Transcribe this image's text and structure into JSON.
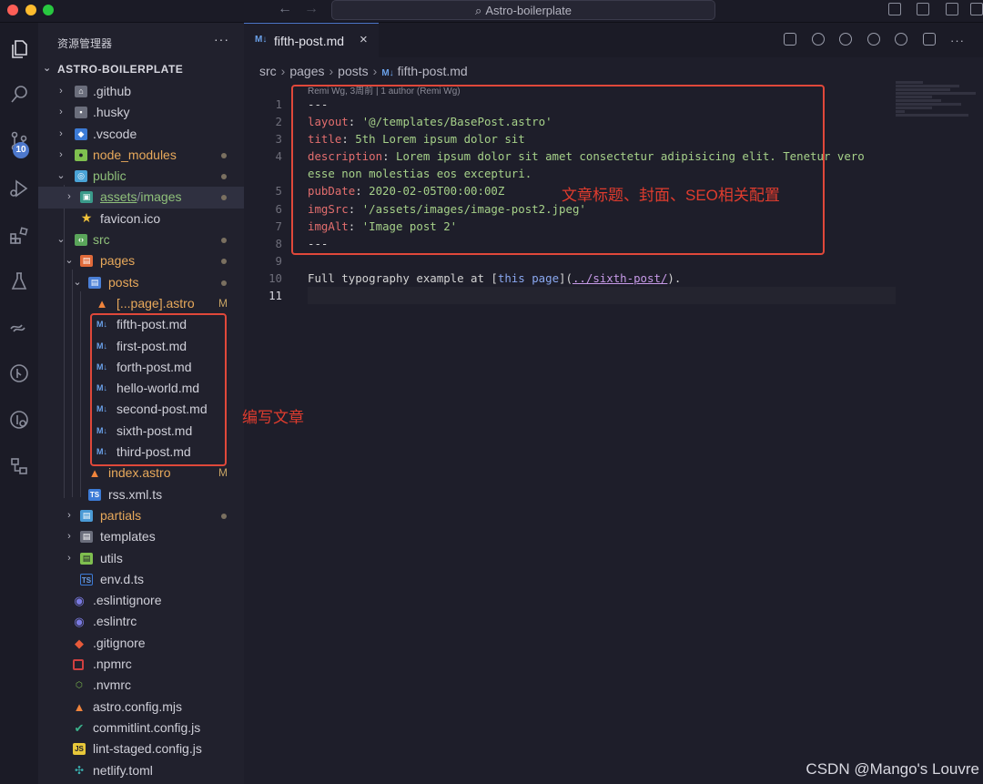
{
  "titlebar": {
    "search": "Astro-boilerplate"
  },
  "activity_bar": {
    "badge": "10"
  },
  "sidebar": {
    "header": "资源管理器",
    "more": "···",
    "root": "ASTRO-BOILERPLATE",
    "items": [
      {
        "label": ".github",
        "type": "folder",
        "status": ""
      },
      {
        "label": ".husky",
        "type": "folder",
        "status": ""
      },
      {
        "label": ".vscode",
        "type": "folder",
        "status": ""
      },
      {
        "label": "node_modules",
        "type": "folder",
        "status": "dot"
      },
      {
        "label": "public",
        "type": "folder-open",
        "status": "dot"
      },
      {
        "label": "assets",
        "label2": "images",
        "type": "folder",
        "status": "dot"
      },
      {
        "label": "favicon.ico",
        "type": "file",
        "status": ""
      },
      {
        "label": "src",
        "type": "folder-open",
        "status": "dot"
      },
      {
        "label": "pages",
        "type": "folder-open",
        "status": "dot"
      },
      {
        "label": "posts",
        "type": "folder-open",
        "status": "dot"
      },
      {
        "label": "[...page].astro",
        "type": "file",
        "status": "M"
      },
      {
        "label": "fifth-post.md",
        "type": "file",
        "status": ""
      },
      {
        "label": "first-post.md",
        "type": "file",
        "status": ""
      },
      {
        "label": "forth-post.md",
        "type": "file",
        "status": ""
      },
      {
        "label": "hello-world.md",
        "type": "file",
        "status": ""
      },
      {
        "label": "second-post.md",
        "type": "file",
        "status": ""
      },
      {
        "label": "sixth-post.md",
        "type": "file",
        "status": ""
      },
      {
        "label": "third-post.md",
        "type": "file",
        "status": ""
      },
      {
        "label": "index.astro",
        "type": "file",
        "status": "M"
      },
      {
        "label": "rss.xml.ts",
        "type": "file",
        "status": ""
      },
      {
        "label": "partials",
        "type": "folder",
        "status": "dot"
      },
      {
        "label": "templates",
        "type": "folder",
        "status": ""
      },
      {
        "label": "utils",
        "type": "folder",
        "status": ""
      },
      {
        "label": "env.d.ts",
        "type": "file",
        "status": ""
      },
      {
        "label": ".eslintignore",
        "type": "file",
        "status": ""
      },
      {
        "label": ".eslintrc",
        "type": "file",
        "status": ""
      },
      {
        "label": ".gitignore",
        "type": "file",
        "status": ""
      },
      {
        "label": ".npmrc",
        "type": "file",
        "status": ""
      },
      {
        "label": ".nvmrc",
        "type": "file",
        "status": ""
      },
      {
        "label": "astro.config.mjs",
        "type": "file",
        "status": ""
      },
      {
        "label": "commitlint.config.js",
        "type": "file",
        "status": ""
      },
      {
        "label": "lint-staged.config.js",
        "type": "file",
        "status": ""
      },
      {
        "label": "netlify.toml",
        "type": "file",
        "status": ""
      }
    ]
  },
  "editor": {
    "tab_label": "fifth-post.md",
    "tab_close": "×",
    "tab_icon": "M↓",
    "breadcrumb": [
      "src",
      "pages",
      "posts",
      "fifth-post.md"
    ],
    "codelens": "Remi Wg, 3周前 | 1 author (Remi Wg)",
    "lines": [
      {
        "n": "1",
        "tokens": [
          [
            "dash",
            "---"
          ]
        ]
      },
      {
        "n": "2",
        "tokens": [
          [
            "key",
            "layout"
          ],
          [
            "plain",
            ": "
          ],
          [
            "str",
            "'@/templates/BasePost.astro'"
          ]
        ]
      },
      {
        "n": "3",
        "tokens": [
          [
            "key",
            "title"
          ],
          [
            "plain",
            ": "
          ],
          [
            "str",
            "5th Lorem ipsum dolor sit"
          ]
        ]
      },
      {
        "n": "4",
        "tokens": [
          [
            "key",
            "description"
          ],
          [
            "plain",
            ": "
          ],
          [
            "str",
            "Lorem ipsum dolor sit amet consectetur adipisicing elit. Tenetur vero"
          ]
        ]
      },
      {
        "n": "",
        "tokens": [
          [
            "str",
            "esse non molestias eos excepturi."
          ]
        ]
      },
      {
        "n": "5",
        "tokens": [
          [
            "key",
            "pubDate"
          ],
          [
            "plain",
            ": "
          ],
          [
            "str",
            "2020-02-05T00:00:00Z"
          ]
        ]
      },
      {
        "n": "6",
        "tokens": [
          [
            "key",
            "imgSrc"
          ],
          [
            "plain",
            ": "
          ],
          [
            "str",
            "'/assets/images/image-post2.jpeg'"
          ]
        ]
      },
      {
        "n": "7",
        "tokens": [
          [
            "key",
            "imgAlt"
          ],
          [
            "plain",
            ": "
          ],
          [
            "str",
            "'Image post 2'"
          ]
        ]
      },
      {
        "n": "8",
        "tokens": [
          [
            "dash",
            "---"
          ]
        ]
      },
      {
        "n": "9",
        "tokens": []
      },
      {
        "n": "10",
        "tokens": [
          [
            "plain",
            "Full typography example at "
          ],
          [
            "plain",
            "["
          ],
          [
            "link",
            "this page"
          ],
          [
            "plain",
            "]("
          ],
          [
            "url",
            "../sixth-post/"
          ],
          [
            "plain",
            ")."
          ]
        ]
      },
      {
        "n": "11",
        "tokens": []
      }
    ]
  },
  "annotations": {
    "frontmatter": "文章标题、封面、SEO相关配置",
    "posts": "编写文章"
  },
  "watermark": "CSDN @Mango's Louvre",
  "colors": {
    "accent": "#4d78cc",
    "annotation": "#e0483a",
    "yaml_key": "#e36e6e",
    "yaml_string": "#a6d189"
  }
}
